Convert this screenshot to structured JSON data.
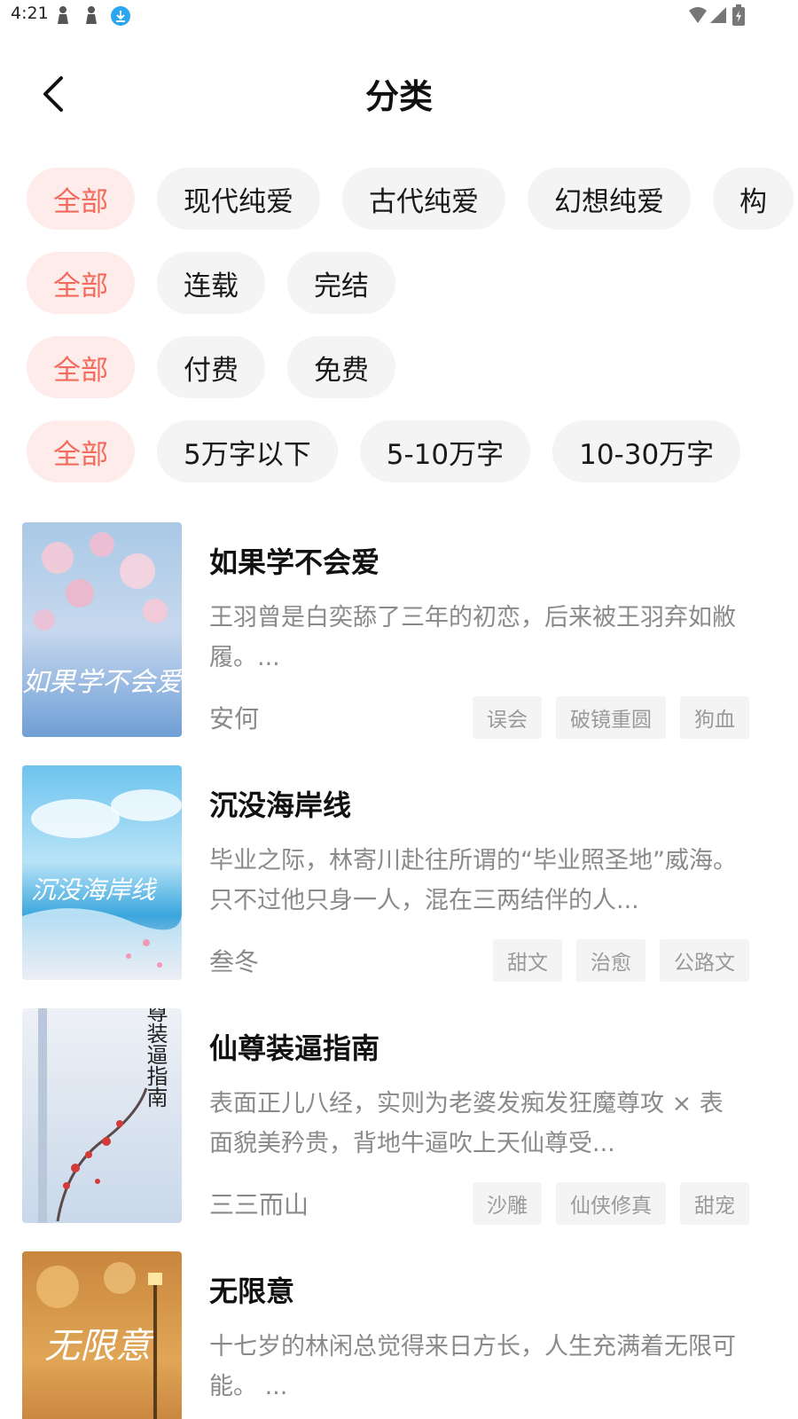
{
  "status_bar": {
    "time": "4:21"
  },
  "header": {
    "title": "分类"
  },
  "filters": {
    "category": {
      "selected": "全部",
      "options": [
        "全部",
        "现代纯爱",
        "古代纯爱",
        "幻想纯爱",
        "构"
      ]
    },
    "status": {
      "selected": "全部",
      "options": [
        "全部",
        "连载",
        "完结"
      ]
    },
    "price": {
      "selected": "全部",
      "options": [
        "全部",
        "付费",
        "免费"
      ]
    },
    "length": {
      "selected": "全部",
      "options": [
        "全部",
        "5万字以下",
        "5-10万字",
        "10-30万字"
      ]
    }
  },
  "books": [
    {
      "title": "如果学不会爱",
      "desc": "王羽曾是白奕舔了三年的初恋，后来被王羽弃如敝履。...",
      "author": "安何",
      "tags": [
        "误会",
        "破镜重圆",
        "狗血"
      ],
      "cover_text": "如果学不会爱"
    },
    {
      "title": "沉没海岸线",
      "desc": "毕业之际，林寄川赴往所谓的“毕业照圣地”威海。只不过他只身一人，混在三两结伴的人...",
      "author": "叁冬",
      "tags": [
        "甜文",
        "治愈",
        "公路文"
      ],
      "cover_text": "沉没海岸线"
    },
    {
      "title": "仙尊装逼指南",
      "desc": "表面正儿八经，实则为老婆发痴发狂魔尊攻 × 表面貌美矜贵，背地牛逼吹上天仙尊受...",
      "author": "三三而山",
      "tags": [
        "沙雕",
        "仙侠修真",
        "甜宠"
      ],
      "cover_text": "仙尊装逼指南"
    },
    {
      "title": "无限意",
      "desc": "十七岁的林闲总觉得来日方长，人生充满着无限可能。 ...",
      "author": "",
      "tags": [],
      "cover_text": "无限意"
    }
  ],
  "colors": {
    "accent": "#f46b5d",
    "accent_bg": "#fdecea",
    "chip_bg": "#f4f4f4"
  }
}
